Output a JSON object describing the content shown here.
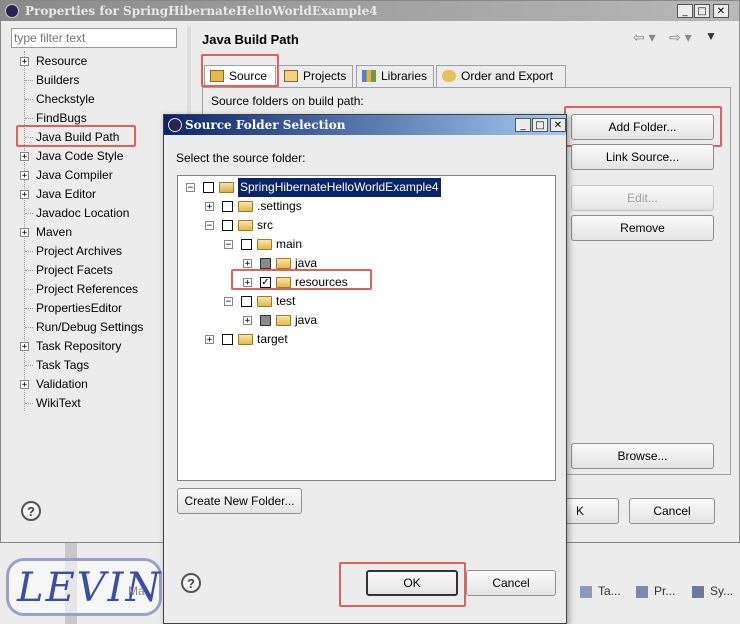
{
  "props_window": {
    "title": "Properties for SpringHibernateHelloWorldExample4",
    "filter_placeholder": "type filter text",
    "items": [
      {
        "label": "Resource",
        "expandable": true
      },
      {
        "label": "Builders",
        "expandable": false
      },
      {
        "label": "Checkstyle",
        "expandable": false
      },
      {
        "label": "FindBugs",
        "expandable": false
      },
      {
        "label": "Java Build Path",
        "expandable": false
      },
      {
        "label": "Java Code Style",
        "expandable": true
      },
      {
        "label": "Java Compiler",
        "expandable": true
      },
      {
        "label": "Java Editor",
        "expandable": true
      },
      {
        "label": "Javadoc Location",
        "expandable": false
      },
      {
        "label": "Maven",
        "expandable": true
      },
      {
        "label": "Project Archives",
        "expandable": false
      },
      {
        "label": "Project Facets",
        "expandable": false
      },
      {
        "label": "Project References",
        "expandable": false
      },
      {
        "label": "PropertiesEditor",
        "expandable": false
      },
      {
        "label": "Run/Debug Settings",
        "expandable": false
      },
      {
        "label": "Task Repository",
        "expandable": true
      },
      {
        "label": "Task Tags",
        "expandable": false
      },
      {
        "label": "Validation",
        "expandable": true
      },
      {
        "label": "WikiText",
        "expandable": false
      }
    ],
    "page_title": "Java Build Path",
    "tabs": [
      "Source",
      "Projects",
      "Libraries",
      "Order and Export"
    ],
    "source_heading": "Source folders on build path:",
    "buttons": {
      "add_folder": "Add Folder...",
      "link_source": "Link Source...",
      "edit": "Edit...",
      "remove": "Remove",
      "browse": "Browse...",
      "ok_partial": "K",
      "cancel": "Cancel"
    },
    "help": "?"
  },
  "dialog": {
    "title": "Source Folder Selection",
    "prompt": "Select the source folder:",
    "tree": [
      {
        "label": "SpringHibernateHelloWorldExample4",
        "level": 0,
        "toggle": "−",
        "check": "empty",
        "selected": true
      },
      {
        "label": ".settings",
        "level": 1,
        "toggle": "+",
        "check": "empty"
      },
      {
        "label": "src",
        "level": 1,
        "toggle": "−",
        "check": "empty"
      },
      {
        "label": "main",
        "level": 2,
        "toggle": "−",
        "check": "empty"
      },
      {
        "label": "java",
        "level": 3,
        "toggle": "+",
        "check": "gray"
      },
      {
        "label": "resources",
        "level": 3,
        "toggle": "+",
        "check": "checked"
      },
      {
        "label": "test",
        "level": 2,
        "toggle": "−",
        "check": "empty"
      },
      {
        "label": "java",
        "level": 3,
        "toggle": "+",
        "check": "gray"
      },
      {
        "label": "target",
        "level": 1,
        "toggle": "+",
        "check": "empty"
      }
    ],
    "create_folder": "Create New Folder...",
    "ok": "OK",
    "cancel": "Cancel",
    "help": "?"
  },
  "taskbar": {
    "items": [
      "Ta...",
      "Pr...",
      "Sy..."
    ],
    "partial": "Ma"
  },
  "watermark": "LEVIN",
  "colors": {
    "title_active": "#0a246a",
    "title_inactive": "#7a96df",
    "selection": "#0a246a",
    "highlight": "#e06060"
  }
}
